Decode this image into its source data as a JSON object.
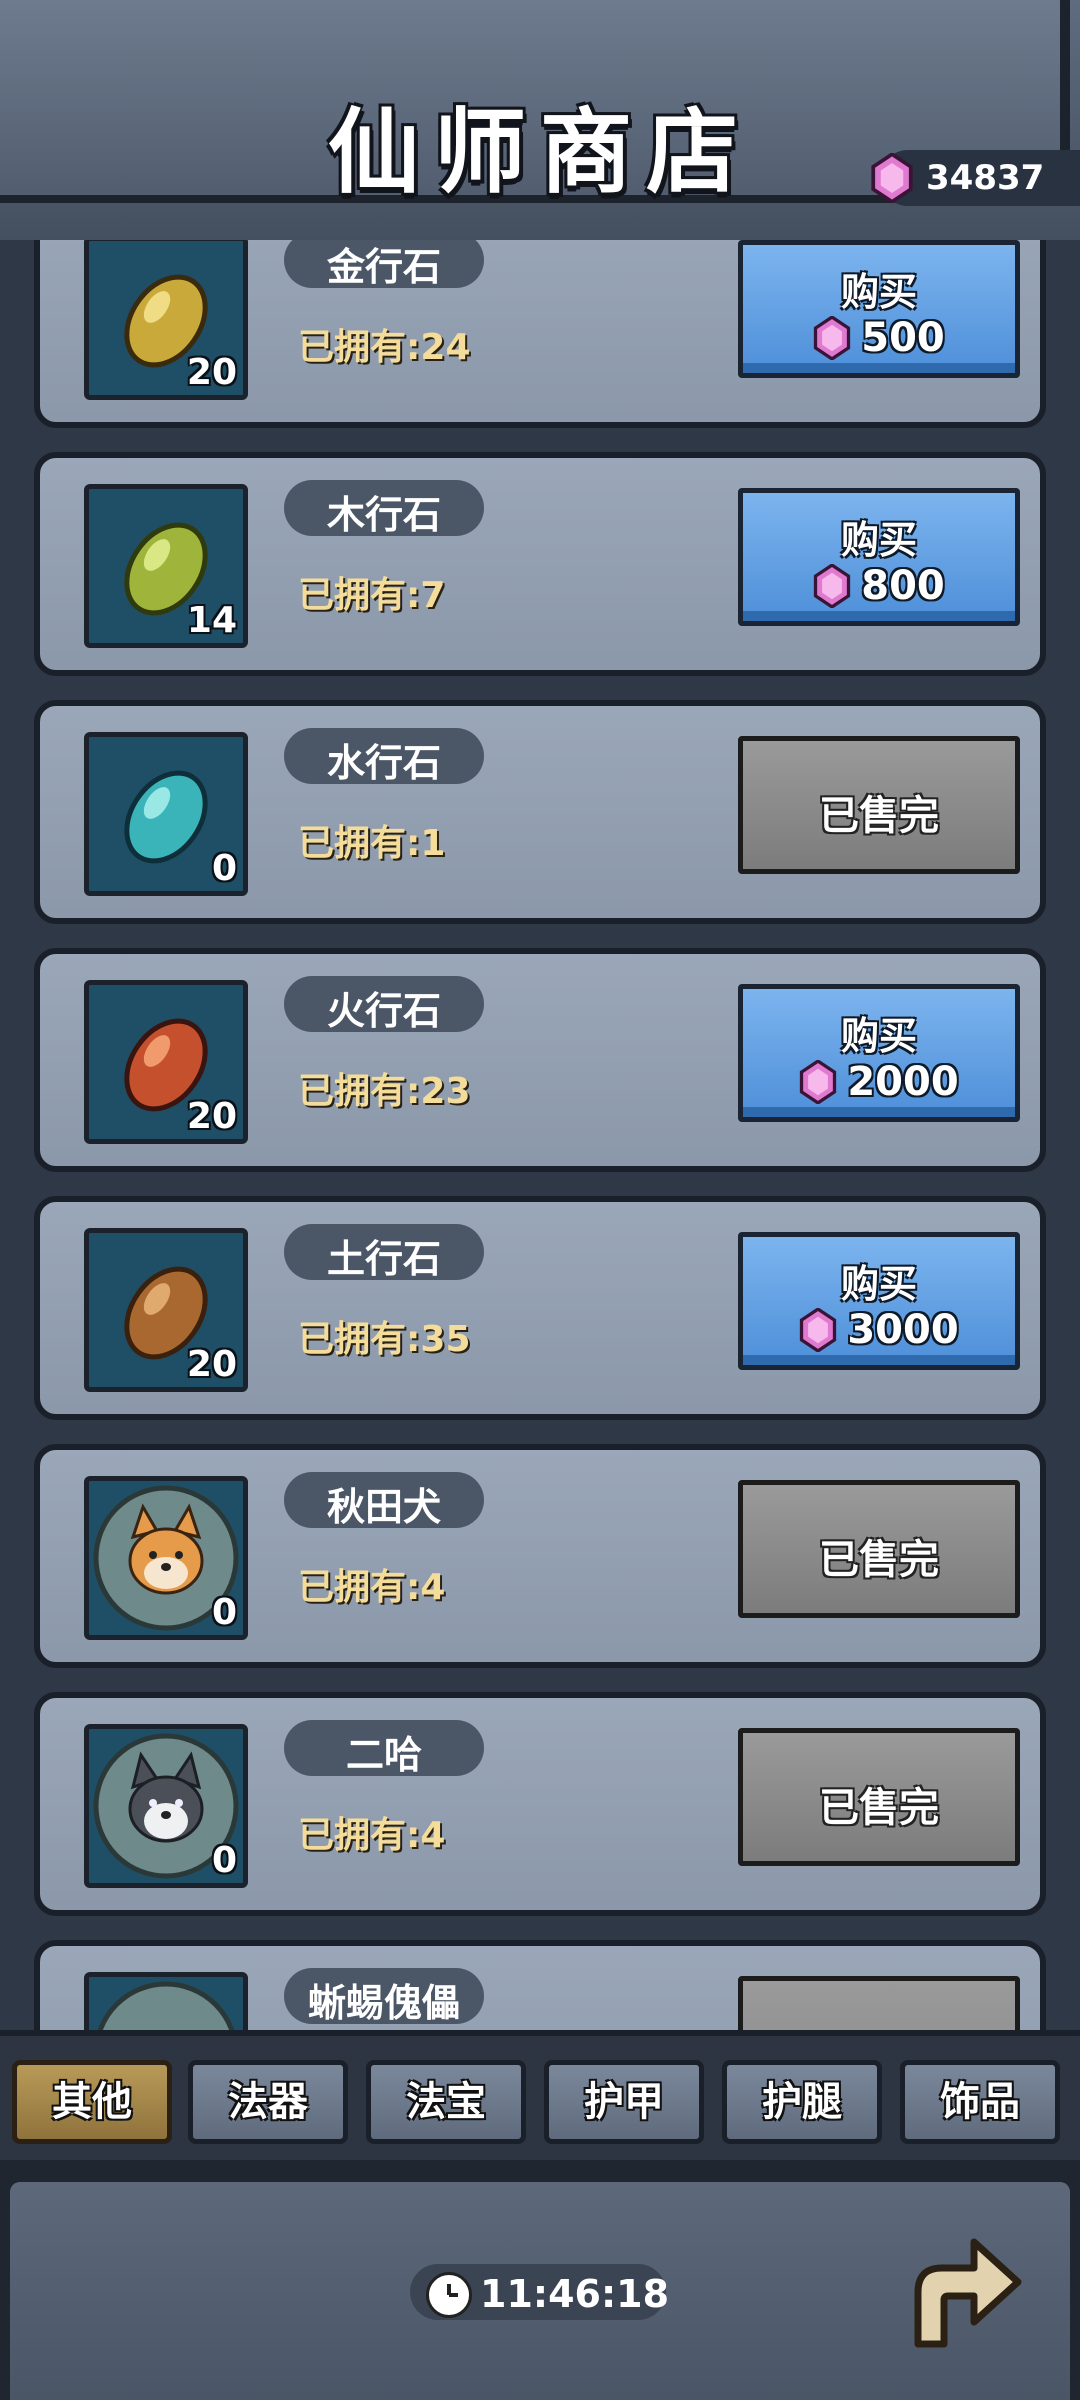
{
  "header": {
    "title": "仙师商店",
    "currency_value": "34837",
    "currency_icon": "gem-icon"
  },
  "items": [
    {
      "name": "金行石",
      "owned": "已拥有:24",
      "count": "20",
      "status": "buy",
      "button_label": "购买",
      "price": "500",
      "color": "#c9a93a"
    },
    {
      "name": "木行石",
      "owned": "已拥有:7",
      "count": "14",
      "status": "buy",
      "button_label": "购买",
      "price": "800",
      "color": "#9fb43a"
    },
    {
      "name": "水行石",
      "owned": "已拥有:1",
      "count": "0",
      "status": "sold",
      "button_label": "已售完",
      "color": "#3ab4b8"
    },
    {
      "name": "火行石",
      "owned": "已拥有:23",
      "count": "20",
      "status": "buy",
      "button_label": "购买",
      "price": "2000",
      "color": "#c4502e"
    },
    {
      "name": "土行石",
      "owned": "已拥有:35",
      "count": "20",
      "status": "buy",
      "button_label": "购买",
      "price": "3000",
      "color": "#a9682f"
    },
    {
      "name": "秋田犬",
      "owned": "已拥有:4",
      "count": "0",
      "status": "sold",
      "button_label": "已售完",
      "icon": "shiba-dog-icon"
    },
    {
      "name": "二哈",
      "owned": "已拥有:4",
      "count": "0",
      "status": "sold",
      "button_label": "已售完",
      "icon": "husky-dog-icon"
    },
    {
      "name": "蜥蜴傀儡",
      "owned": "",
      "count": "",
      "status": "partial"
    }
  ],
  "tabs": [
    {
      "label": "其他",
      "active": true
    },
    {
      "label": "法器",
      "active": false
    },
    {
      "label": "法宝",
      "active": false
    },
    {
      "label": "护甲",
      "active": false
    },
    {
      "label": "护腿",
      "active": false
    },
    {
      "label": "饰品",
      "active": false
    }
  ],
  "footer": {
    "timer": "11:46:18",
    "back_icon": "back-arrow-icon"
  }
}
